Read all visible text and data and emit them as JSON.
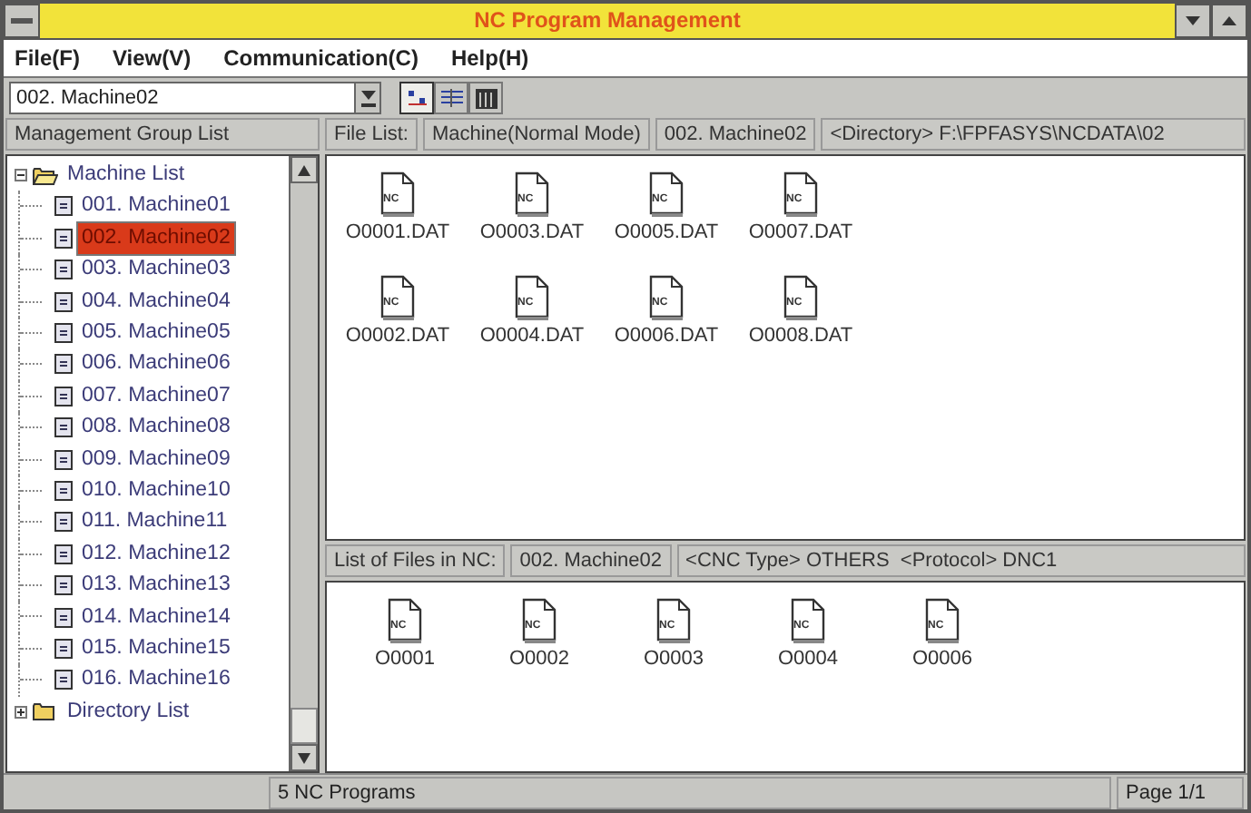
{
  "window": {
    "title": "NC Program Management"
  },
  "menu": [
    "File(F)",
    "View(V)",
    "Communication(C)",
    "Help(H)"
  ],
  "toolbar": {
    "machine_select": {
      "value": "002. Machine02"
    },
    "view_buttons": [
      {
        "kind": "large-icons",
        "selected": true
      },
      {
        "kind": "list",
        "selected": false
      },
      {
        "kind": "details",
        "selected": false
      }
    ]
  },
  "sidebar": {
    "header": "Management Group List",
    "groups": [
      {
        "label": "Machine List",
        "expanded": true,
        "children": [
          {
            "label": "001. Machine01",
            "selected": false
          },
          {
            "label": "002. Machine02",
            "selected": true
          },
          {
            "label": "003. Machine03",
            "selected": false
          },
          {
            "label": "004. Machine04",
            "selected": false
          },
          {
            "label": "005. Machine05",
            "selected": false
          },
          {
            "label": "006. Machine06",
            "selected": false
          },
          {
            "label": "007. Machine07",
            "selected": false
          },
          {
            "label": "008. Machine08",
            "selected": false
          },
          {
            "label": "009. Machine09",
            "selected": false
          },
          {
            "label": "010. Machine10",
            "selected": false
          },
          {
            "label": "011. Machine11",
            "selected": false
          },
          {
            "label": "012. Machine12",
            "selected": false
          },
          {
            "label": "013. Machine13",
            "selected": false
          },
          {
            "label": "014. Machine14",
            "selected": false
          },
          {
            "label": "015. Machine15",
            "selected": false
          },
          {
            "label": "016. Machine16",
            "selected": false
          }
        ]
      },
      {
        "label": "Directory List",
        "expanded": false
      }
    ]
  },
  "file_list": {
    "header": [
      "File List:",
      "Machine(Normal Mode)",
      "002. Machine02",
      "<Directory> F:\\FPFASYS\\NCDATA\\02"
    ],
    "files": [
      {
        "name": "O0001.DAT",
        "badge": "NC"
      },
      {
        "name": "O0003.DAT",
        "badge": "NC"
      },
      {
        "name": "O0005.DAT",
        "badge": "NC"
      },
      {
        "name": "O0007.DAT",
        "badge": "NC"
      },
      {
        "name": "O0002.DAT",
        "badge": "NC"
      },
      {
        "name": "O0004.DAT",
        "badge": "NC"
      },
      {
        "name": "O0006.DAT",
        "badge": "NC"
      },
      {
        "name": "O0008.DAT",
        "badge": "NC"
      }
    ]
  },
  "nc_list": {
    "header": [
      "List of Files in NC:",
      "002. Machine02",
      "<CNC Type> OTHERS  <Protocol> DNC1"
    ],
    "files": [
      {
        "name": "O0001",
        "badge": "NC"
      },
      {
        "name": "O0002",
        "badge": "NC"
      },
      {
        "name": "O0003",
        "badge": "NC"
      },
      {
        "name": "O0004",
        "badge": "NC"
      },
      {
        "name": "O0006",
        "badge": "NC"
      }
    ]
  },
  "status_bar": [
    "5 NC Programs",
    "Page 1/1"
  ]
}
